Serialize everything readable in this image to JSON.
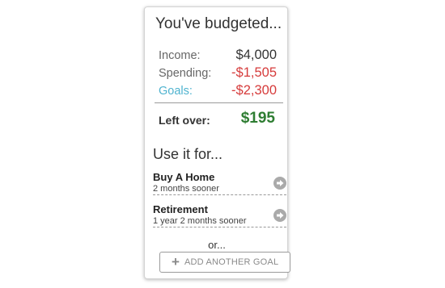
{
  "summary": {
    "title": "You've budgeted...",
    "income_label": "Income:",
    "income_value": "$4,000",
    "spending_label": "Spending:",
    "spending_value": "-$1,505",
    "goals_label": "Goals:",
    "goals_value": "-$2,300",
    "leftover_label": "Left over:",
    "leftover_value": "$195"
  },
  "suggestions": {
    "heading": "Use it for...",
    "goals": [
      {
        "name": "Buy A Home",
        "detail": "2 months sooner",
        "icon": "arrow-right-circle-icon"
      },
      {
        "name": "Retirement",
        "detail": "1 year 2 months sooner",
        "icon": "arrow-right-circle-icon"
      }
    ],
    "or_label": "or...",
    "add_goal_label": "ADD ANOTHER GOAL",
    "add_icon": "plus-icon"
  },
  "colors": {
    "income": "#333333",
    "negative": "#d63b3b",
    "goals_label": "#4fb3cf",
    "leftover": "#2e7d32",
    "arrow_icon": "#aaaaaa"
  }
}
